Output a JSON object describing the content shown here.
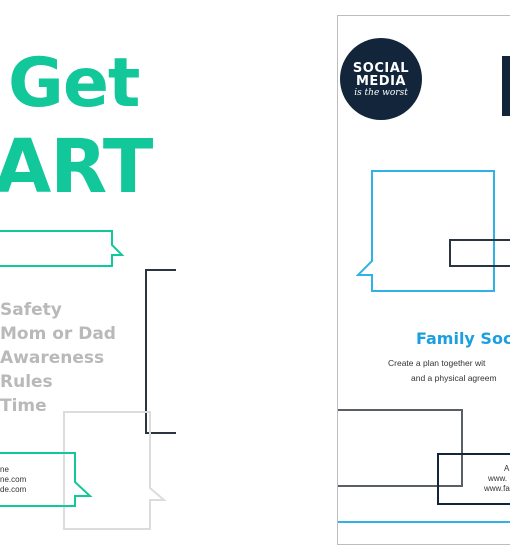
{
  "left_poster": {
    "title_line1": "Get",
    "title_line2": "ART",
    "list_items": [
      "Safety",
      "Mom or Dad",
      "Awareness",
      "Rules",
      "Time"
    ],
    "footer_lines": [
      "ne",
      "ne.com",
      "de.com"
    ]
  },
  "right_poster": {
    "logo_line1": "SOCIAL",
    "logo_line2": "MEDIA",
    "logo_tagline": "is the worst",
    "heading": "Family Soc",
    "desc_line1": "Create a plan together wit",
    "desc_line2": "and a physical agreem",
    "footer_lines": [
      "A",
      "www.",
      "www.fa"
    ]
  },
  "colors": {
    "teal": "#12c79a",
    "blue": "#1b9fe0",
    "navy": "#12253a",
    "gray_text": "#b9b9b9"
  }
}
